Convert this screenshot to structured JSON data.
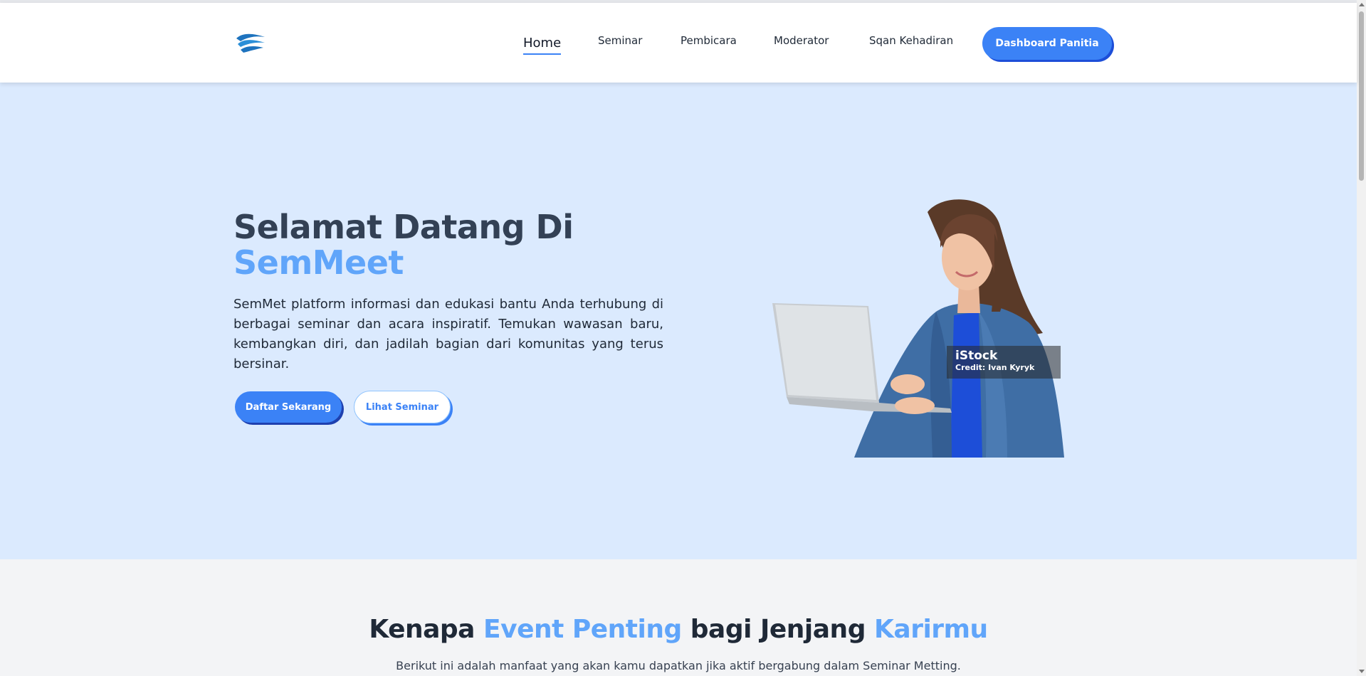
{
  "header": {
    "logo_icon": "wave-logo-icon",
    "nav": [
      {
        "label": "Home",
        "active": true
      },
      {
        "label": "Seminar"
      },
      {
        "label": "Pembicara"
      },
      {
        "label": "Moderator"
      },
      {
        "label": "Sqan Kehadiran"
      }
    ],
    "dashboard_button": "Dashboard Panitia"
  },
  "hero": {
    "title_line1": "Selamat Datang Di",
    "title_line2": "SemMeet",
    "description": "SemMet platform informasi dan edukasi bantu Anda terhubung di berbagai seminar dan acara inspiratif. Temukan wawasan baru, kembangkan diri, dan jadilah bagian dari komunitas yang terus bersinar.",
    "primary_button": "Daftar Sekarang",
    "secondary_button": "Lihat Seminar",
    "image_credit_brand": "iStock",
    "image_credit_author": "Credit: Ivan Kyryk"
  },
  "section": {
    "title_part1": "Kenapa ",
    "title_part2": "Event Penting",
    "title_part3": " bagi Jenjang ",
    "title_part4": "Karirmu",
    "subtitle": "Berikut ini adalah manfaat yang akan kamu dapatkan jika aktif bergabung dalam Seminar Metting."
  },
  "colors": {
    "accent": "#3b82f6",
    "accent_light": "#60a5fa",
    "hero_bg": "#dbeafe",
    "heading": "#334155"
  }
}
